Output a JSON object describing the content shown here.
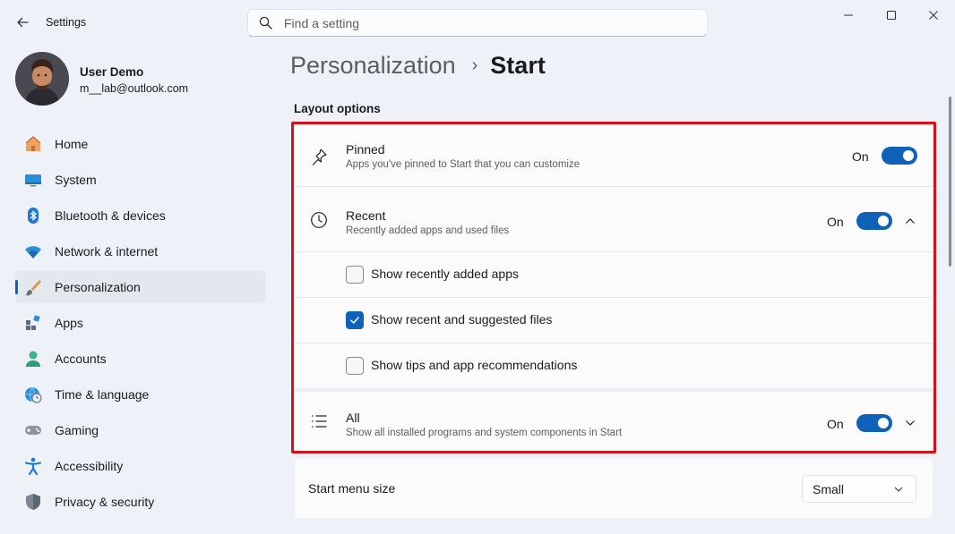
{
  "window": {
    "app_title": "Settings",
    "search_placeholder": "Find a setting"
  },
  "user": {
    "name": "User Demo",
    "email": "m__lab@outlook.com"
  },
  "sidebar": {
    "items": [
      {
        "label": "Home",
        "icon": "home-icon"
      },
      {
        "label": "System",
        "icon": "system-icon"
      },
      {
        "label": "Bluetooth & devices",
        "icon": "bluetooth-icon"
      },
      {
        "label": "Network & internet",
        "icon": "wifi-icon"
      },
      {
        "label": "Personalization",
        "icon": "brush-icon",
        "active": true
      },
      {
        "label": "Apps",
        "icon": "apps-icon"
      },
      {
        "label": "Accounts",
        "icon": "accounts-icon"
      },
      {
        "label": "Time & language",
        "icon": "globe-clock-icon"
      },
      {
        "label": "Gaming",
        "icon": "gamepad-icon"
      },
      {
        "label": "Accessibility",
        "icon": "accessibility-icon"
      },
      {
        "label": "Privacy & security",
        "icon": "shield-icon"
      }
    ]
  },
  "breadcrumb": {
    "parent": "Personalization",
    "separator": "›",
    "current": "Start"
  },
  "layout_options": {
    "section_title": "Layout options",
    "pinned": {
      "title": "Pinned",
      "description": "Apps you've pinned to Start that you can customize",
      "toggle_state": "On",
      "enabled": true
    },
    "recent": {
      "title": "Recent",
      "description": "Recently added apps and used files",
      "toggle_state": "On",
      "enabled": true,
      "expanded": true,
      "options": [
        {
          "label": "Show recently added apps",
          "checked": false
        },
        {
          "label": "Show recent and suggested files",
          "checked": true
        },
        {
          "label": "Show tips and app recommendations",
          "checked": false
        }
      ]
    },
    "all": {
      "title": "All",
      "description": "Show all installed programs and system components in Start",
      "toggle_state": "On",
      "enabled": true,
      "expanded": false
    }
  },
  "start_menu_size": {
    "label": "Start menu size",
    "value": "Small"
  },
  "colors": {
    "accent": "#0f62b8",
    "highlight_border": "#d6111b",
    "background": "#eef2f8",
    "card": "#fbfbfc"
  }
}
